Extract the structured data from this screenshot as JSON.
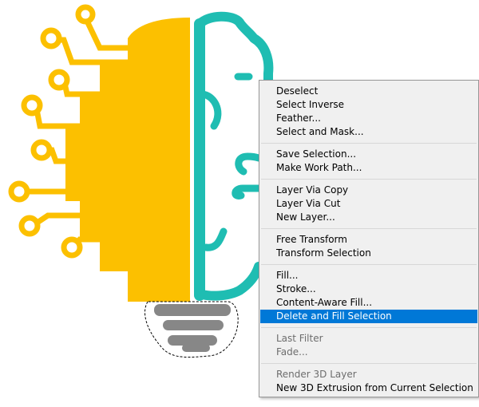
{
  "canvas": {
    "image": "brain-lightbulb-illustration",
    "colors": {
      "left_half": "#fcc000",
      "right_half": "#1fbdb2",
      "base": "#878787",
      "selection_marquee": "#000000"
    }
  },
  "context_menu": {
    "colors": {
      "background": "#f0f0f0",
      "border": "#979797",
      "highlight": "#0078d7",
      "separator": "#d7d7d7",
      "disabled_text": "#6d6d6d"
    },
    "groups": [
      [
        {
          "label": "Deselect",
          "enabled": true
        },
        {
          "label": "Select Inverse",
          "enabled": true
        },
        {
          "label": "Feather...",
          "enabled": true
        },
        {
          "label": "Select and Mask...",
          "enabled": true
        }
      ],
      [
        {
          "label": "Save Selection...",
          "enabled": true
        },
        {
          "label": "Make Work Path...",
          "enabled": true
        }
      ],
      [
        {
          "label": "Layer Via Copy",
          "enabled": true
        },
        {
          "label": "Layer Via Cut",
          "enabled": true
        },
        {
          "label": "New Layer...",
          "enabled": true
        }
      ],
      [
        {
          "label": "Free Transform",
          "enabled": true
        },
        {
          "label": "Transform Selection",
          "enabled": true
        }
      ],
      [
        {
          "label": "Fill...",
          "enabled": true
        },
        {
          "label": "Stroke...",
          "enabled": true
        },
        {
          "label": "Content-Aware Fill...",
          "enabled": true
        },
        {
          "label": "Delete and Fill Selection",
          "enabled": true,
          "highlighted": true
        }
      ],
      [
        {
          "label": "Last Filter",
          "enabled": false
        },
        {
          "label": "Fade...",
          "enabled": false
        }
      ],
      [
        {
          "label": "Render 3D Layer",
          "enabled": false
        },
        {
          "label": "New 3D Extrusion from Current Selection",
          "enabled": true
        }
      ]
    ]
  }
}
